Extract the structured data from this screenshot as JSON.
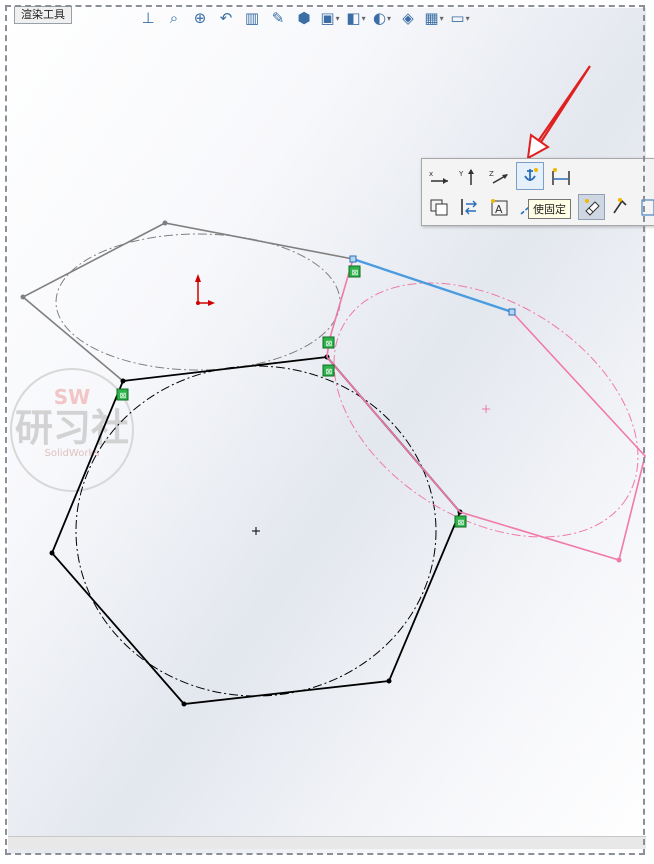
{
  "tab": {
    "label": "渲染工具"
  },
  "toolbar": {
    "icons": [
      "view-orientation-icon",
      "zoom-to-fit-icon",
      "zoom-to-area-icon",
      "previous-view-icon",
      "section-view-icon",
      "dynamic-annotation-icon",
      "view-orientation-cube-icon",
      "display-style-icon",
      "hide-show-icon",
      "edit-appearance-icon",
      "apply-scene-icon",
      "view-settings-icon",
      "screen-capture-icon"
    ]
  },
  "context_toolbar": {
    "row1": [
      "horizontal-icon",
      "vertical-icon",
      "coincident-axis-icon",
      "fix-icon",
      "dimension-icon"
    ],
    "row2": [
      "copy-entities-icon",
      "convert-entities-icon",
      "add-text-icon",
      "construction-icon",
      "active-tool-icon",
      "smart-dimension-icon",
      "more-icon"
    ]
  },
  "tooltip": {
    "text": "使固定"
  },
  "watermark": {
    "line1": "SW",
    "line2": "研习社",
    "line3": "SolidWorks"
  },
  "colors": {
    "gray_polygon": "#808080",
    "black_polygon": "#000000",
    "pink_polygon": "#f07aa8",
    "selected_line": "#4a9be0",
    "relation_marker": "#2db34a",
    "arrow_annotation": "#e02020"
  }
}
